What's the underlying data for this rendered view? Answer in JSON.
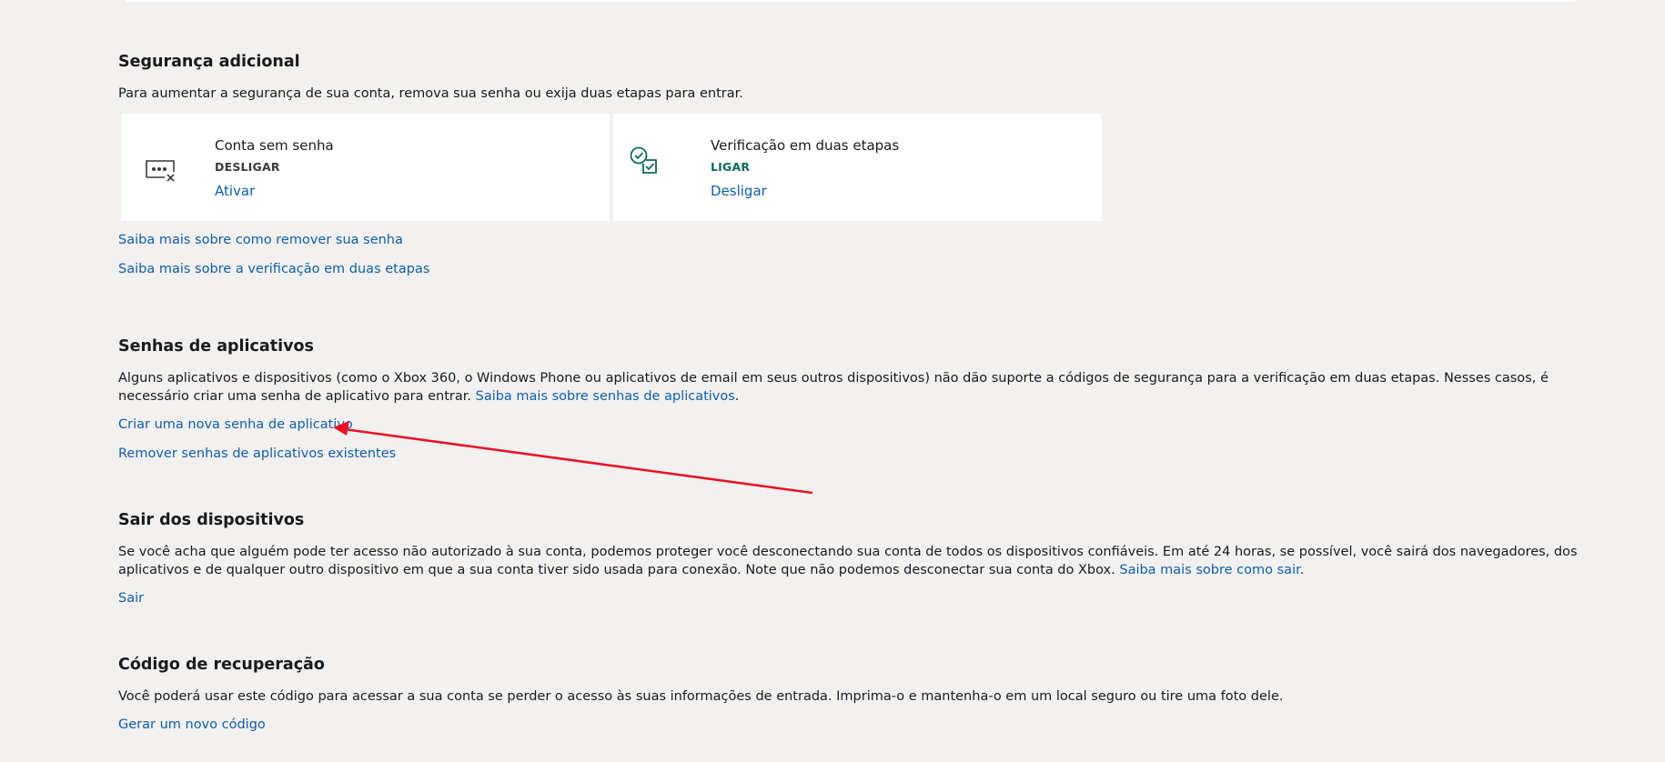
{
  "security": {
    "title": "Segurança adicional",
    "description": "Para aumentar a segurança de sua conta, remova sua senha ou exija duas etapas para entrar.",
    "cards": [
      {
        "icon": "passwordless-icon",
        "title": "Conta sem senha",
        "status": "DESLIGAR",
        "status_color": "#3b3a39",
        "action": "Ativar"
      },
      {
        "icon": "two-step-verification-icon",
        "title": "Verificação em duas etapas",
        "status": "LIGAR",
        "status_color": "#0b6a5b",
        "action": "Desligar"
      }
    ],
    "link_remove_password": "Saiba mais sobre como remover sua senha",
    "link_two_step": "Saiba mais sobre a verificação em duas etapas"
  },
  "app_passwords": {
    "title": "Senhas de aplicativos",
    "description": "Alguns aplicativos e dispositivos (como o Xbox 360, o Windows Phone ou aplicativos de email em seus outros dispositivos) não dão suporte a códigos de segurança para a verificação em duas etapas. Nesses casos, é necessário criar uma senha de aplicativo para entrar.",
    "description_link": "Saiba mais sobre senhas de aplicativos",
    "description_end": ".",
    "create_link": "Criar uma nova senha de aplicativo",
    "remove_link": "Remover senhas de aplicativos existentes"
  },
  "sign_out": {
    "title": "Sair dos dispositivos",
    "description": "Se você acha que alguém pode ter acesso não autorizado à sua conta, podemos proteger você desconectando sua conta de todos os dispositivos confiáveis. Em até 24 horas, se possível, você sairá dos navegadores, dos aplicativos e de qualquer outro dispositivo em que a sua conta tiver sido usada para conexão. Note que não podemos desconectar sua conta do Xbox.",
    "description_link": "Saiba mais sobre como sair",
    "description_end": ".",
    "action": "Sair"
  },
  "recovery": {
    "title": "Código de recuperação",
    "description": "Você poderá usar este código para acessar a sua conta se perder o acesso às suas informações de entrada. Imprima-o e mantenha-o em um local seguro ou tire uma foto dele.",
    "action": "Gerar um novo código"
  },
  "colors": {
    "link": "#0f5ea8",
    "background": "#f2f1f0",
    "card": "#ffffff",
    "accent_teal": "#0b6a5b",
    "annotation_arrow": "#e81123"
  }
}
